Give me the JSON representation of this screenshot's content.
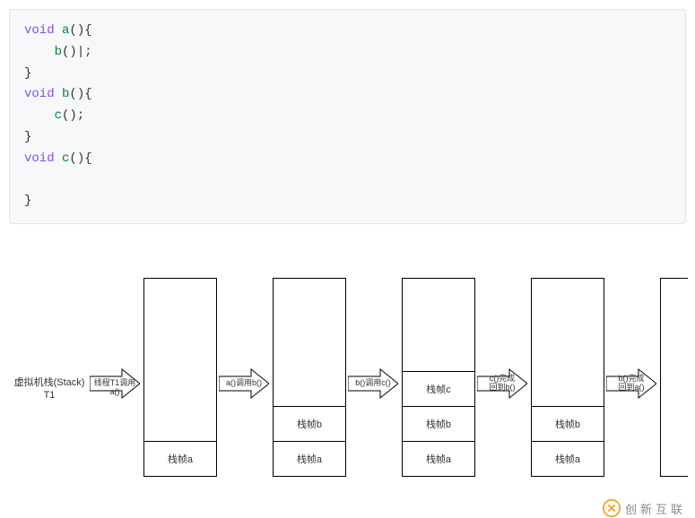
{
  "code": {
    "l1a": "void",
    "l1b": " a(){",
    "l2": "    b()|;",
    "l3": "}",
    "l4a": "void",
    "l4b": " b(){",
    "l5": "    c();",
    "l6": "}",
    "l7a": "void",
    "l7b": " c(){",
    "l8": "",
    "l9": "}",
    "fn_a": "a",
    "fn_b": "b",
    "fn_c": "c"
  },
  "diagram": {
    "stack_label_l1": "虚拟机栈(Stack)",
    "stack_label_l2": "T1",
    "arrow1": "线程T1调用a()",
    "arrow2": "a()调用b()",
    "arrow3": "b()调用c()",
    "arrow4_l1": "c()完成",
    "arrow4_l2": "回到b()",
    "arrow5_l1": "b()完成",
    "arrow5_l2": "回到a()",
    "frame_a": "栈帧a",
    "frame_b": "栈帧b",
    "frame_c": "栈帧c"
  },
  "watermark": "创新互联"
}
